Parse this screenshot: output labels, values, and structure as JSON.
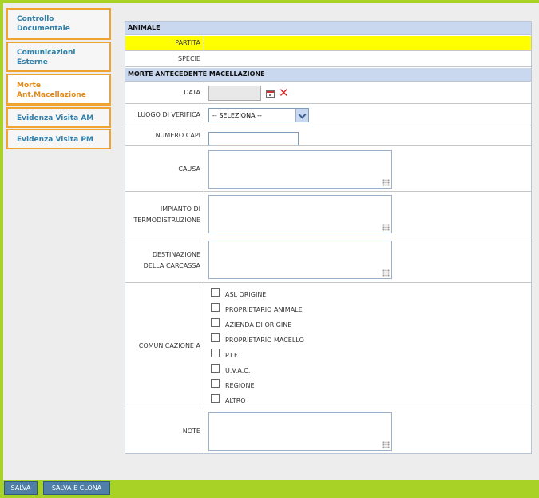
{
  "sidebar": {
    "items": [
      {
        "line1": "Controllo",
        "line2": "Documentale"
      },
      {
        "line1": "Comunicazioni",
        "line2": "Esterne"
      },
      {
        "line1": "Morte",
        "line2": "Ant.Macellazione"
      },
      {
        "line1": "Evidenza Visita AM",
        "line2": ""
      },
      {
        "line1": "Evidenza Visita PM",
        "line2": ""
      }
    ]
  },
  "form": {
    "animale_header": "ANIMALE",
    "partita_label": "PARTITA",
    "partita_value": "",
    "specie_label": "SPECIE",
    "specie_value": "",
    "morte_header": "MORTE ANTECEDENTE MACELLAZIONE",
    "data_label": "DATA",
    "data_value": "",
    "luogo_label": "LUOGO DI VERIFICA",
    "luogo_selected": "-- SELEZIONA --",
    "numero_capi_label": "NUMERO CAPI",
    "numero_capi_value": "",
    "causa_label": "CAUSA",
    "causa_value": "",
    "impianto_line1": "IMPIANTO DI",
    "impianto_line2": "TERMODISTRUZIONE",
    "impianto_value": "",
    "destinazione_line1": "DESTINAZIONE",
    "destinazione_line2": "DELLA CARCASSA",
    "destinazione_value": "",
    "comunicazione_label": "COMUNICAZIONE A",
    "comunicazione_options": [
      {
        "label": "ASL ORIGINE",
        "checked": false
      },
      {
        "label": "PROPRIETARIO ANIMALE",
        "checked": false
      },
      {
        "label": "AZIENDA DI ORIGINE",
        "checked": false
      },
      {
        "label": "PROPRIETARIO MACELLO",
        "checked": false
      },
      {
        "label": "P.I.F.",
        "checked": false
      },
      {
        "label": "U.V.A.C.",
        "checked": false
      },
      {
        "label": "REGIONE",
        "checked": false
      },
      {
        "label": "ALTRO",
        "checked": false
      }
    ],
    "note_label": "NOTE",
    "note_value": ""
  },
  "footer": {
    "salva_label": "SALVA",
    "salva_clona_label": "SALVA E CLONA"
  },
  "colors": {
    "frame_green": "#a8d226",
    "tab_orange": "#f0a32e",
    "link_blue": "#2f7fa8",
    "active_orange": "#e08a1a",
    "section_header": "#c9d7ef",
    "highlight_yellow": "#ffff00",
    "button_blue": "#4f7fa6"
  },
  "icons": {
    "calendar": "calendar-icon",
    "clear": "close-icon",
    "dropdown": "chevron-down-icon",
    "resize": "resize-grip-icon"
  }
}
